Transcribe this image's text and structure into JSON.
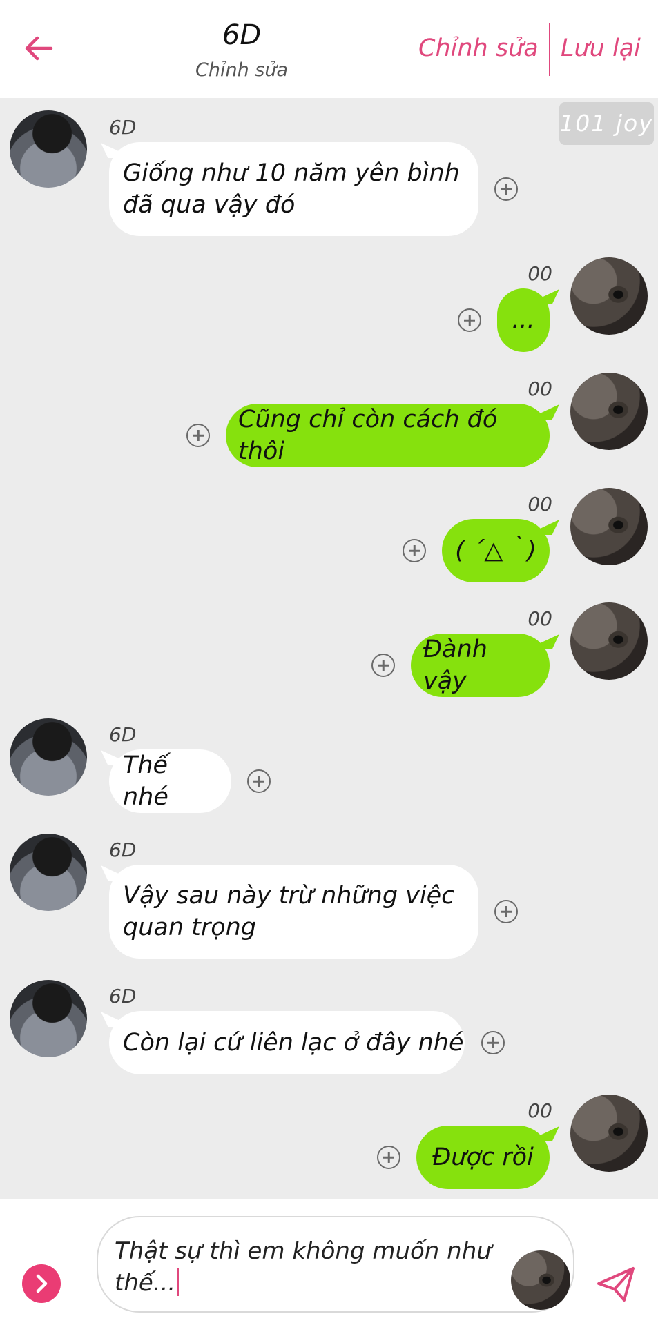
{
  "header": {
    "title": "6D",
    "subtitle": "Chỉnh sửa",
    "edit_label": "Chỉnh sửa",
    "save_label": "Lưu lại"
  },
  "watermark": "101 joy",
  "colors": {
    "accent": "#e0487d",
    "sent_bubble": "#86e10d",
    "received_bubble": "#ffffff",
    "background": "#ececec"
  },
  "messages": [
    {
      "sender": "6D",
      "side": "left",
      "text": "Giống như 10 năm yên bình\nđã qua vậy đó"
    },
    {
      "sender": "00",
      "side": "right",
      "text": "..."
    },
    {
      "sender": "00",
      "side": "right",
      "text": "Cũng chỉ còn cách đó thôi"
    },
    {
      "sender": "00",
      "side": "right",
      "text": "( ´△｀)"
    },
    {
      "sender": "00",
      "side": "right",
      "text": "Đành vậy"
    },
    {
      "sender": "6D",
      "side": "left",
      "text": "Thế nhé"
    },
    {
      "sender": "6D",
      "side": "left",
      "text": "Vậy sau này trừ những việc\nquan trọng"
    },
    {
      "sender": "6D",
      "side": "left",
      "text": "Còn lại cứ liên lạc ở đây nhé"
    },
    {
      "sender": "00",
      "side": "right",
      "text": "Được rồi"
    }
  ],
  "composer": {
    "text": "Thật sự thì em không muốn như thế..."
  },
  "icons": {
    "back": "arrow-left-icon",
    "plus": "plus-circle-icon",
    "toggle": "chevron-right-icon",
    "send": "paper-plane-icon"
  }
}
